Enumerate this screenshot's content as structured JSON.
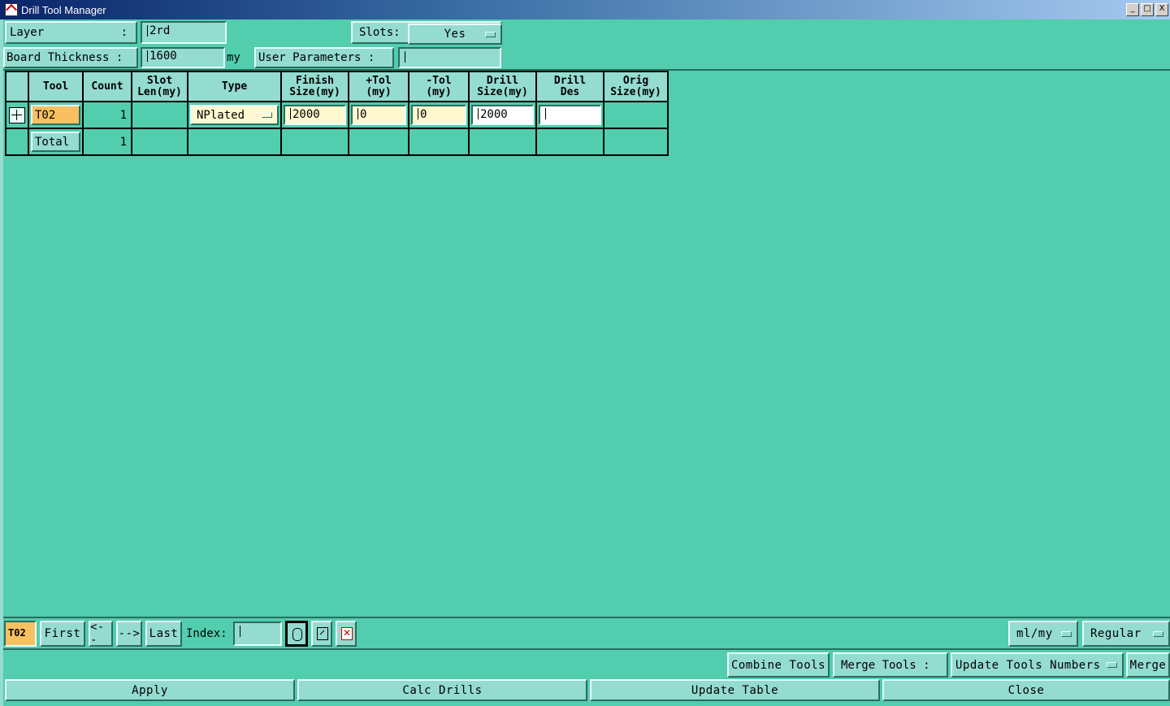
{
  "window": {
    "title": "Drill Tool Manager",
    "controls": [
      "_",
      "□",
      "X"
    ]
  },
  "header": {
    "layer_label": "Layer",
    "layer_colon": ":",
    "layer_value": "2rd",
    "slots_label": "Slots:",
    "slots_value": "Yes",
    "board_thickness_label": "Board Thickness :",
    "board_thickness_value": "1600",
    "board_thickness_unit": "my",
    "user_params_label": "User Parameters :",
    "user_params_value": ""
  },
  "table": {
    "headers": {
      "tool": "Tool",
      "count": "Count",
      "slot_len_1": "Slot",
      "slot_len_2": "Len(my)",
      "type": "Type",
      "finish_1": "Finish",
      "finish_2": "Size(my)",
      "ptol_1": "+Tol",
      "ptol_2": "(my)",
      "mtol_1": "-Tol",
      "mtol_2": "(my)",
      "drill_1": "Drill",
      "drill_2": "Size(my)",
      "drilldes_1": "Drill",
      "drilldes_2": "Des",
      "orig_1": "Orig",
      "orig_2": "Size(my)"
    },
    "row": {
      "tool": "T02",
      "count": "1",
      "type": "NPlated",
      "finish": "2000",
      "ptol": "0",
      "mtol": "0",
      "drill": "2000",
      "drill_des": ""
    },
    "total": {
      "label": "Total",
      "count": "1"
    }
  },
  "nav": {
    "current_tool": "T02",
    "first": "First",
    "prev": "<--",
    "next": "-->",
    "last": "Last",
    "index_label": "Index:",
    "index_value": "",
    "units": "ml/my",
    "mode": "Regular"
  },
  "actions": {
    "combine": "Combine Tools",
    "merge_label": "Merge Tools :",
    "merge_option": "Update Tools Numbers",
    "merge": "Merge",
    "apply": "Apply",
    "calc": "Calc Drills",
    "update": "Update Table",
    "close": "Close"
  },
  "colors": {
    "background": "#52cdae",
    "widget": "#94dbd0",
    "highlight_orange": "#f8c060",
    "editable_yellow": "#fff8d0",
    "title_bar": "#0a246a"
  }
}
